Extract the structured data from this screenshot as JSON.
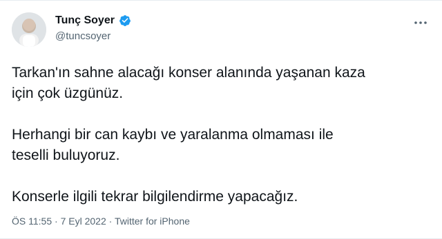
{
  "tweet": {
    "author": {
      "name": "Tunç Soyer",
      "handle": "@tuncsoyer",
      "verified": true,
      "avatar_icon": "profile-photo"
    },
    "paragraphs": [
      "Tarkan'ın sahne alacağı konser alanında yaşanan kaza\niçin çok üzgünüz.",
      "Herhangi bir can kaybı ve yaralanma olmaması ile\nteselli buluyoruz.",
      "Konserle ilgili tekrar bilgilendirme yapacağız."
    ],
    "meta": {
      "time": "ÖS 11:55",
      "separator": " · ",
      "date": "7 Eyl 2022",
      "source": "Twitter for iPhone"
    },
    "colors": {
      "verified": "#1d9bf0",
      "text": "#0f1419",
      "muted": "#536471"
    },
    "more_icon": "ellipsis-icon"
  }
}
